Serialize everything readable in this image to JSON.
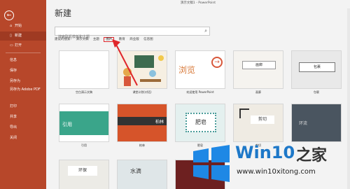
{
  "app": {
    "window_title": "演示文稿1 - PowerPoint"
  },
  "sidebar": {
    "items": [
      {
        "label": "开始",
        "icon": "home-icon"
      },
      {
        "label": "新建",
        "icon": "new-file-icon"
      },
      {
        "label": "打开",
        "icon": "folder-icon"
      },
      {
        "label": "信息"
      },
      {
        "label": "保存"
      },
      {
        "label": "另存为"
      },
      {
        "label": "另存为 Adobe PDF"
      },
      {
        "label": "打印"
      },
      {
        "label": "共享"
      },
      {
        "label": "导出"
      },
      {
        "label": "关闭"
      }
    ]
  },
  "main": {
    "heading": "新建",
    "search_placeholder": "搜索联机模板和主题",
    "suggest_prefix": "建议的搜索:",
    "suggestions": [
      "演示文稿",
      "主题",
      "图片",
      "教育",
      "商业版",
      "信息图"
    ]
  },
  "templates": [
    {
      "label": "空白演示文稿"
    },
    {
      "label": "欢迎使用 PowerPoint",
      "title": "浏览"
    },
    {
      "label": "画廊",
      "title": "画廊"
    },
    {
      "label": "包裹",
      "title": "包裹"
    },
    {
      "label": "引用",
      "title": "引用"
    },
    {
      "label": "柏林",
      "title": "柏林"
    },
    {
      "label": "肥皂",
      "title": "肥皂"
    },
    {
      "label": "剪切",
      "title": "剪切"
    },
    {
      "label": "环保",
      "title": "环保"
    },
    {
      "label": "水滴",
      "title": "水滴"
    },
    {
      "label": "",
      "title": "环流"
    }
  ],
  "watermark": {
    "brand": "Win10",
    "brand2": "之家",
    "url": "www.win10xitong.com"
  },
  "colors": {
    "sidebar": "#b7472a",
    "accent": "#e0262b"
  }
}
